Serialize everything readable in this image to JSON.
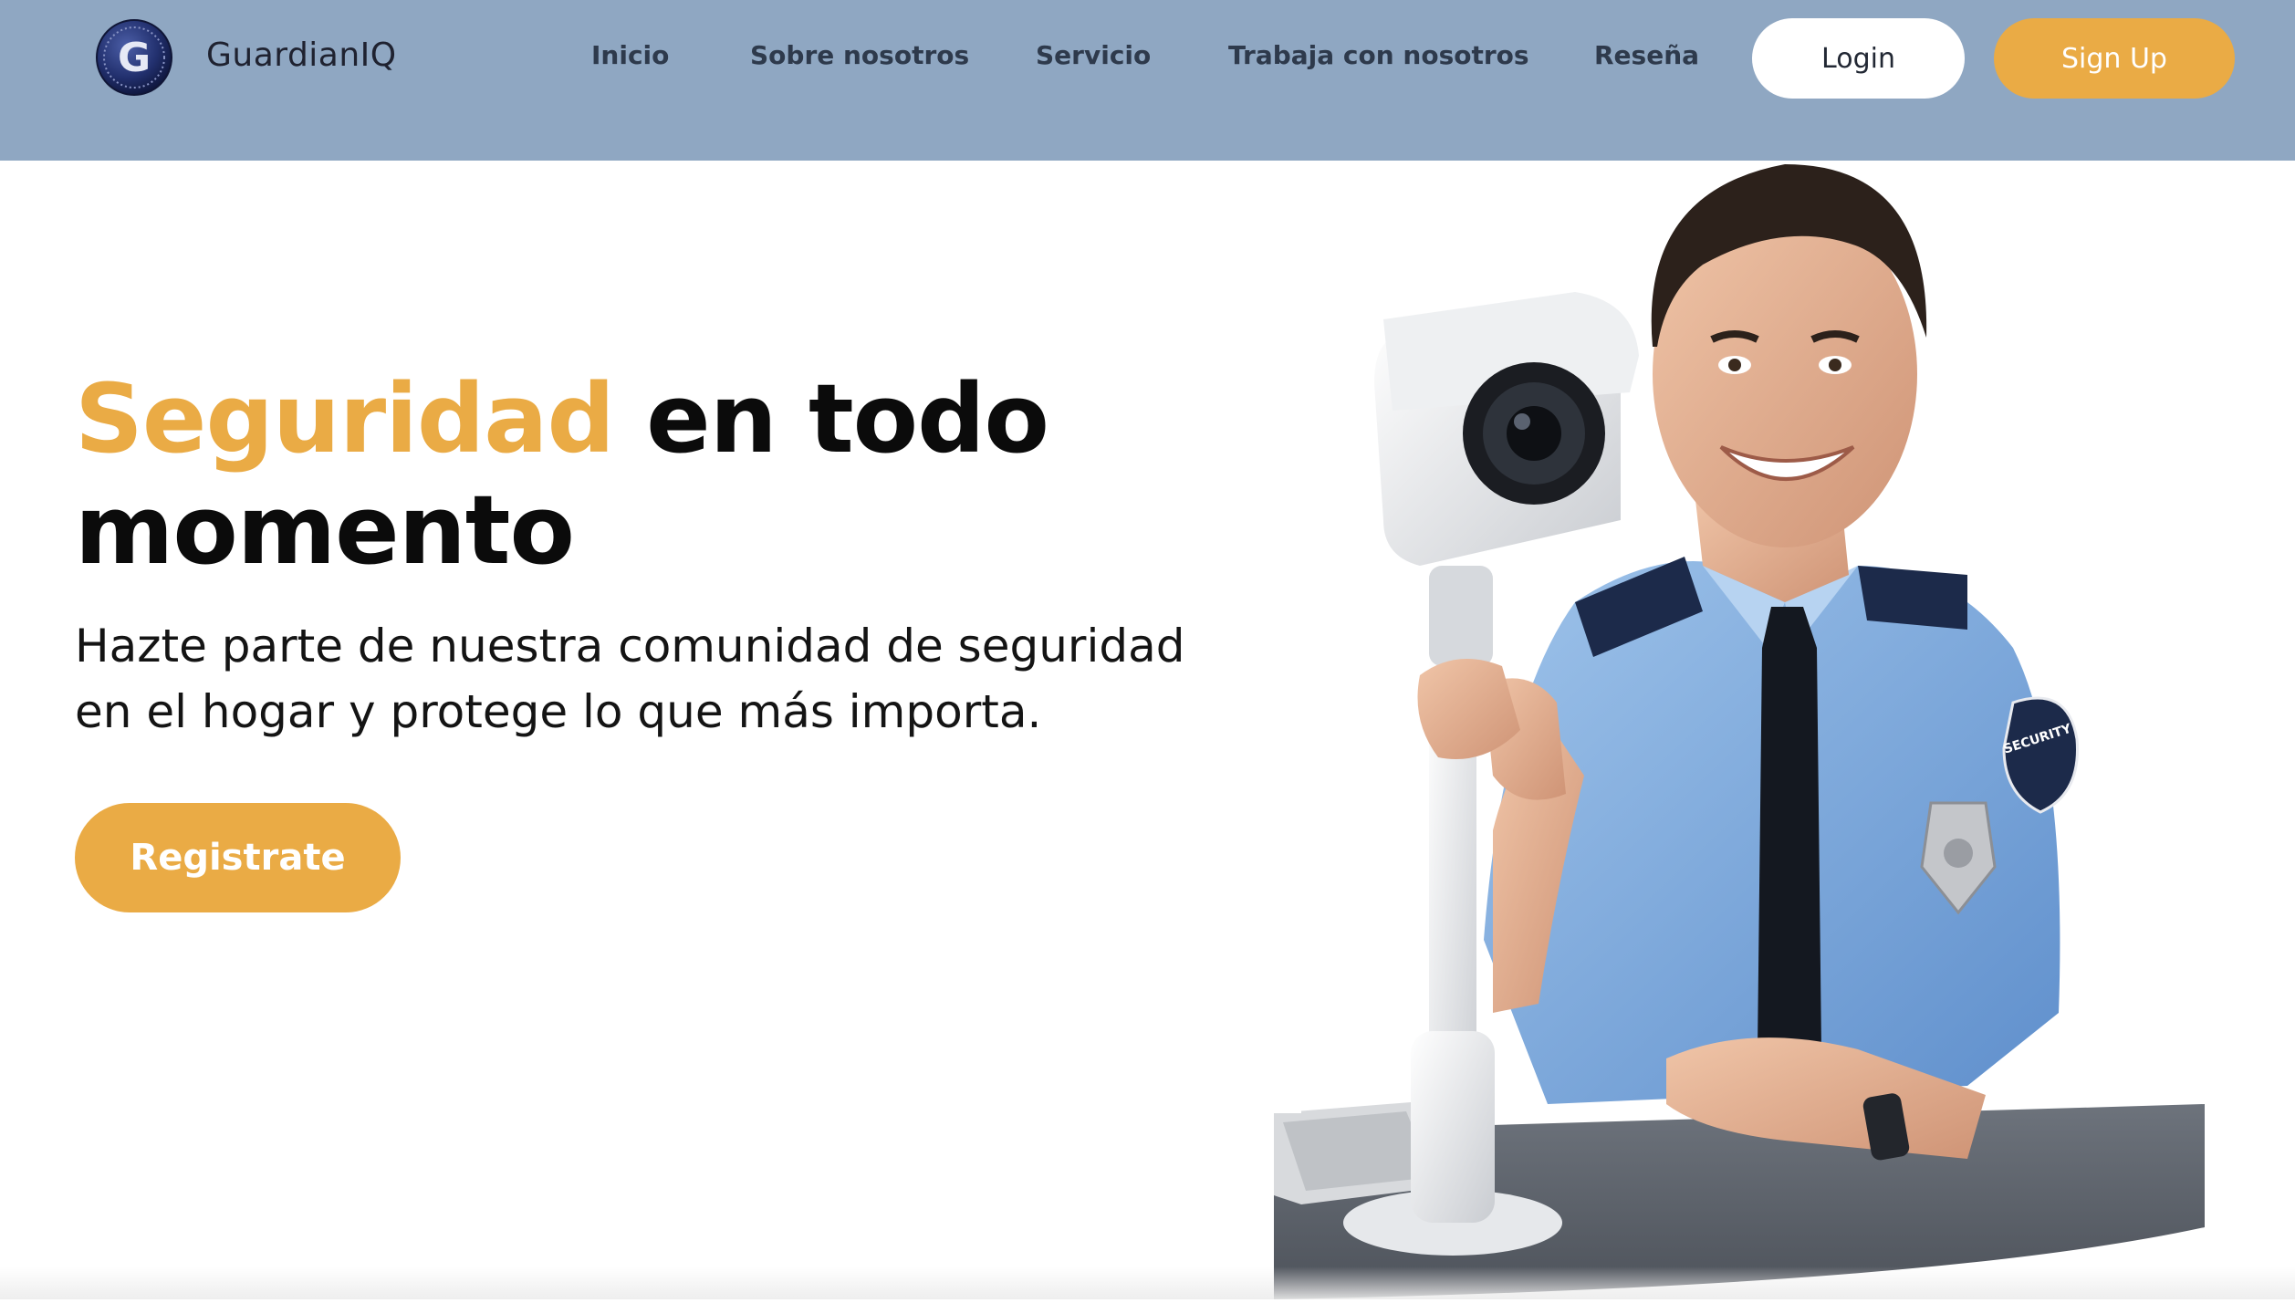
{
  "brand": {
    "name": "GuardianIQ",
    "logo_letter": "G"
  },
  "nav": {
    "items": [
      {
        "label": "Inicio"
      },
      {
        "label": "Sobre nosotros"
      },
      {
        "label": "Servicio"
      },
      {
        "label": "Trabaja con nosotros"
      },
      {
        "label": "Reseña"
      }
    ],
    "login_label": "Login",
    "signup_label": "Sign Up"
  },
  "hero": {
    "title_accent": "Seguridad",
    "title_rest_line1": "en todo",
    "title_line2": "momento",
    "subtitle": "Hazte parte de nuestra comunidad de seguridad en el hogar y protege lo que más importa.",
    "cta_label": "Registrate",
    "image_badge_text": "SECURITY"
  },
  "colors": {
    "navbar_bg": "#8fa7c2",
    "accent": "#eaab45",
    "text_dark": "#0b0b0b"
  }
}
